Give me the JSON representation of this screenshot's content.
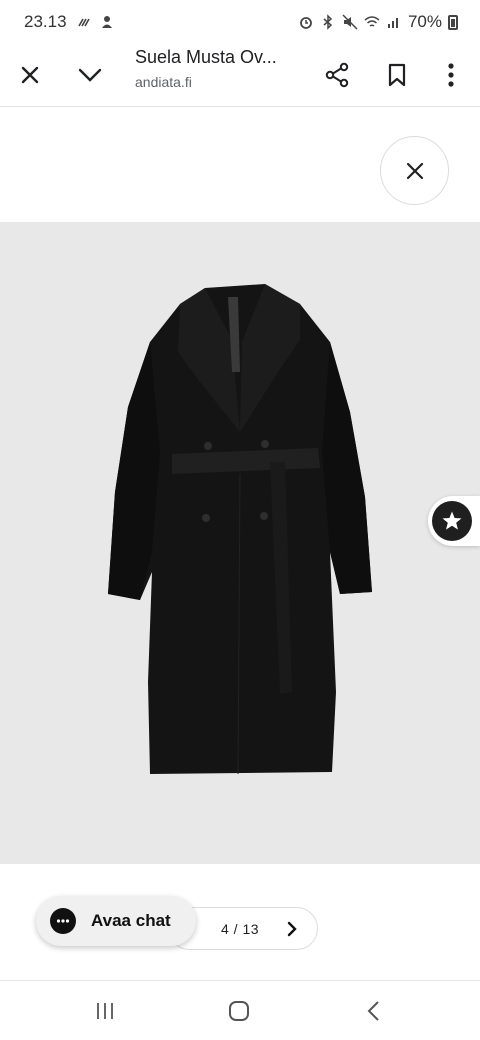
{
  "status_bar": {
    "time": "23.13",
    "battery_percent": "70%",
    "icons_left": [
      "signal-activity-icon",
      "notification-icon"
    ],
    "icons_right": [
      "alarm-icon",
      "bluetooth-icon",
      "mute-icon",
      "wifi-icon",
      "cell-signal-icon",
      "battery-icon"
    ]
  },
  "toolbar": {
    "page_title": "Suela Musta Ov...",
    "domain": "andiata.fi",
    "icons": [
      "close-icon",
      "chevron-down-icon",
      "share-icon",
      "bookmark-icon",
      "more-vert-icon"
    ]
  },
  "gallery": {
    "close_icon": "close-icon",
    "image_alt": "black-trench-coat",
    "current": "4",
    "total": "13",
    "pager_text": "4 / 13",
    "next_icon": "chevron-right-icon"
  },
  "floating": {
    "star_icon": "star-icon"
  },
  "chat": {
    "label": "Avaa chat",
    "icon": "chat-bubble-icon"
  },
  "navbar": {
    "icons": [
      "recents-icon",
      "home-icon",
      "back-icon"
    ]
  },
  "colors": {
    "image_bg": "#e8e8e8",
    "coat": "#111111",
    "chat_bg": "#f0f0f0"
  }
}
